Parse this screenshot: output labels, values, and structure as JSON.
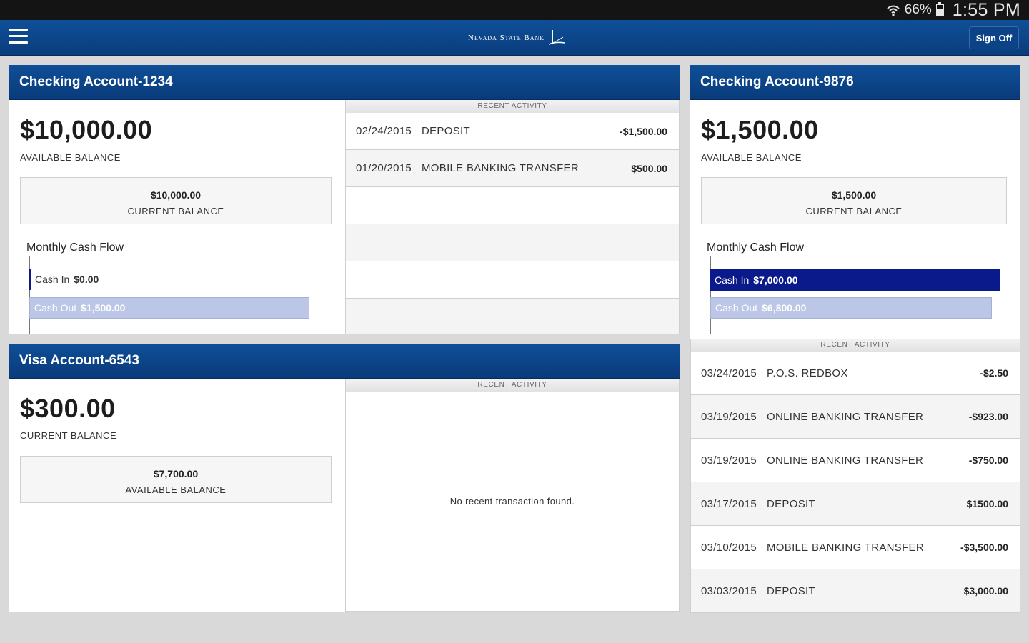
{
  "status_bar": {
    "battery": "66%",
    "time": "1:55 PM",
    "battery_level": 0.66
  },
  "header": {
    "logo_text": "Nevada State Bank",
    "sign_off_label": "Sign Off",
    "menu_icon": "hamburger-menu-icon"
  },
  "accounts": {
    "checking1234": {
      "title": "Checking Account-1234",
      "primary_balance": "$10,000.00",
      "primary_label": "AVAILABLE BALANCE",
      "secondary_balance": "$10,000.00",
      "secondary_label": "CURRENT BALANCE",
      "cash_flow": {
        "title": "Monthly Cash Flow",
        "in_label": "Cash In",
        "in_value": "$0.00",
        "in_amount": 0,
        "out_label": "Cash Out",
        "out_value": "$1,500.00",
        "out_amount": 1500
      },
      "activity_header": "RECENT ACTIVITY",
      "activity": [
        {
          "date": "02/24/2015",
          "desc": "DEPOSIT",
          "amount": "-$1,500.00"
        },
        {
          "date": "01/20/2015",
          "desc": "MOBILE BANKING TRANSFER",
          "amount": "$500.00"
        }
      ]
    },
    "visa6543": {
      "title": "Visa Account-6543",
      "primary_balance": "$300.00",
      "primary_label": "CURRENT BALANCE",
      "secondary_balance": "$7,700.00",
      "secondary_label": "AVAILABLE BALANCE",
      "activity_header": "RECENT ACTIVITY",
      "empty_message": "No recent transaction found."
    },
    "checking9876": {
      "title": "Checking Account-9876",
      "primary_balance": "$1,500.00",
      "primary_label": "AVAILABLE BALANCE",
      "secondary_balance": "$1,500.00",
      "secondary_label": "CURRENT BALANCE",
      "cash_flow": {
        "title": "Monthly Cash Flow",
        "in_label": "Cash In",
        "in_value": "$7,000.00",
        "in_amount": 7000,
        "out_label": "Cash Out",
        "out_value": "$6,800.00",
        "out_amount": 6800
      },
      "activity_header": "RECENT ACTIVITY",
      "activity": [
        {
          "date": "03/24/2015",
          "desc": "P.O.S. REDBOX",
          "amount": "-$2.50"
        },
        {
          "date": "03/19/2015",
          "desc": "ONLINE BANKING TRANSFER",
          "amount": "-$923.00"
        },
        {
          "date": "03/19/2015",
          "desc": "ONLINE BANKING TRANSFER",
          "amount": "-$750.00"
        },
        {
          "date": "03/17/2015",
          "desc": "DEPOSIT",
          "amount": "$1500.00"
        },
        {
          "date": "03/10/2015",
          "desc": "MOBILE BANKING TRANSFER",
          "amount": "-$3,500.00"
        },
        {
          "date": "03/03/2015",
          "desc": "DEPOSIT",
          "amount": "$3,000.00"
        }
      ]
    }
  },
  "colors": {
    "header_blue": "#0f4f98",
    "cash_in": "#0a1a8a",
    "cash_out": "#bcc6e6",
    "background": "#d9d9d9"
  }
}
